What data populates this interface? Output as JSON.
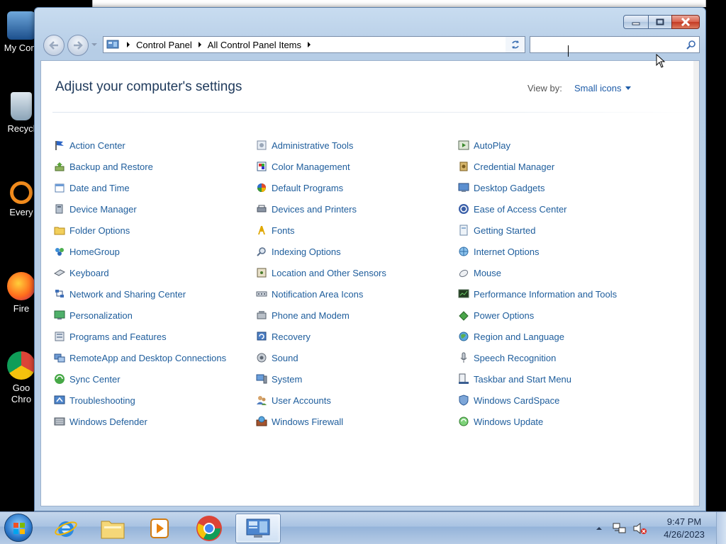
{
  "desktop": {
    "icons": [
      {
        "label": "My Com"
      },
      {
        "label": "Recycl"
      },
      {
        "label": "Every"
      },
      {
        "label": "Fire"
      },
      {
        "label": "Goo"
      },
      {
        "label": "Chro"
      }
    ]
  },
  "window": {
    "address": {
      "crumbs": [
        "Control Panel",
        "All Control Panel Items"
      ]
    },
    "search": {
      "placeholder": "",
      "value": ""
    },
    "title": "Adjust your computer's settings",
    "view_by": {
      "label": "View by:",
      "value": "Small icons"
    },
    "items": [
      {
        "label": "Action Center",
        "icon": "flag-icon"
      },
      {
        "label": "Administrative Tools",
        "icon": "tools-icon"
      },
      {
        "label": "AutoPlay",
        "icon": "autoplay-icon"
      },
      {
        "label": "Backup and Restore",
        "icon": "backup-icon"
      },
      {
        "label": "Color Management",
        "icon": "color-icon"
      },
      {
        "label": "Credential Manager",
        "icon": "credential-icon"
      },
      {
        "label": "Date and Time",
        "icon": "calendar-icon"
      },
      {
        "label": "Default Programs",
        "icon": "default-programs-icon"
      },
      {
        "label": "Desktop Gadgets",
        "icon": "gadgets-icon"
      },
      {
        "label": "Device Manager",
        "icon": "device-manager-icon"
      },
      {
        "label": "Devices and Printers",
        "icon": "printer-icon"
      },
      {
        "label": "Ease of Access Center",
        "icon": "accessibility-icon"
      },
      {
        "label": "Folder Options",
        "icon": "folder-icon"
      },
      {
        "label": "Fonts",
        "icon": "fonts-icon"
      },
      {
        "label": "Getting Started",
        "icon": "getting-started-icon"
      },
      {
        "label": "HomeGroup",
        "icon": "homegroup-icon"
      },
      {
        "label": "Indexing Options",
        "icon": "indexing-icon"
      },
      {
        "label": "Internet Options",
        "icon": "internet-icon"
      },
      {
        "label": "Keyboard",
        "icon": "keyboard-icon"
      },
      {
        "label": "Location and Other Sensors",
        "icon": "location-icon"
      },
      {
        "label": "Mouse",
        "icon": "mouse-icon"
      },
      {
        "label": "Network and Sharing Center",
        "icon": "network-icon"
      },
      {
        "label": "Notification Area Icons",
        "icon": "notification-icon"
      },
      {
        "label": "Performance Information and Tools",
        "icon": "performance-icon"
      },
      {
        "label": "Personalization",
        "icon": "personalization-icon"
      },
      {
        "label": "Phone and Modem",
        "icon": "phone-icon"
      },
      {
        "label": "Power Options",
        "icon": "power-icon"
      },
      {
        "label": "Programs and Features",
        "icon": "programs-icon"
      },
      {
        "label": "Recovery",
        "icon": "recovery-icon"
      },
      {
        "label": "Region and Language",
        "icon": "globe-icon"
      },
      {
        "label": "RemoteApp and Desktop Connections",
        "icon": "remoteapp-icon"
      },
      {
        "label": "Sound",
        "icon": "speaker-icon"
      },
      {
        "label": "Speech Recognition",
        "icon": "microphone-icon"
      },
      {
        "label": "Sync Center",
        "icon": "sync-icon"
      },
      {
        "label": "System",
        "icon": "system-icon"
      },
      {
        "label": "Taskbar and Start Menu",
        "icon": "taskbar-icon"
      },
      {
        "label": "Troubleshooting",
        "icon": "troubleshooting-icon"
      },
      {
        "label": "User Accounts",
        "icon": "users-icon"
      },
      {
        "label": "Windows CardSpace",
        "icon": "cardspace-icon"
      },
      {
        "label": "Windows Defender",
        "icon": "defender-icon"
      },
      {
        "label": "Windows Firewall",
        "icon": "firewall-icon"
      },
      {
        "label": "Windows Update",
        "icon": "update-icon"
      }
    ]
  },
  "taskbar": {
    "clock": {
      "time": "9:47 PM",
      "date": "4/26/2023"
    }
  },
  "colors": {
    "link": "#1e5d9c",
    "title": "#1e395b",
    "close": "#c43a24"
  }
}
